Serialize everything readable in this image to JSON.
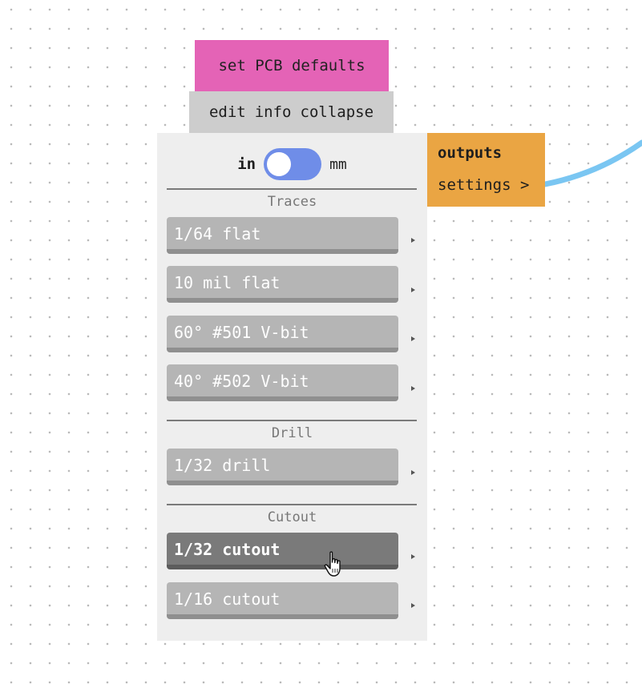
{
  "header": {
    "title": "set PCB defaults",
    "menu": [
      "edit",
      "info",
      "collapse"
    ]
  },
  "units": {
    "left": "in",
    "right": "mm",
    "selected": "in"
  },
  "sections": {
    "traces": {
      "label": "Traces",
      "buttons": [
        "1/64 flat",
        "10 mil flat",
        "60° #501 V-bit",
        "40° #502 V-bit"
      ]
    },
    "drill": {
      "label": "Drill",
      "buttons": [
        "1/32 drill"
      ]
    },
    "cutout": {
      "label": "Cutout",
      "buttons": [
        "1/32 cutout",
        "1/16 cutout"
      ],
      "active_index": 0
    }
  },
  "outputs": {
    "title": "outputs",
    "settings": "settings >"
  },
  "colors": {
    "title_bg": "#e463b6",
    "menu_bg": "#cdcdcd",
    "panel_bg": "#eeeeee",
    "toggle": "#6f8de8",
    "outputs_bg": "#eaa543",
    "wire": "#7ac6f2"
  }
}
